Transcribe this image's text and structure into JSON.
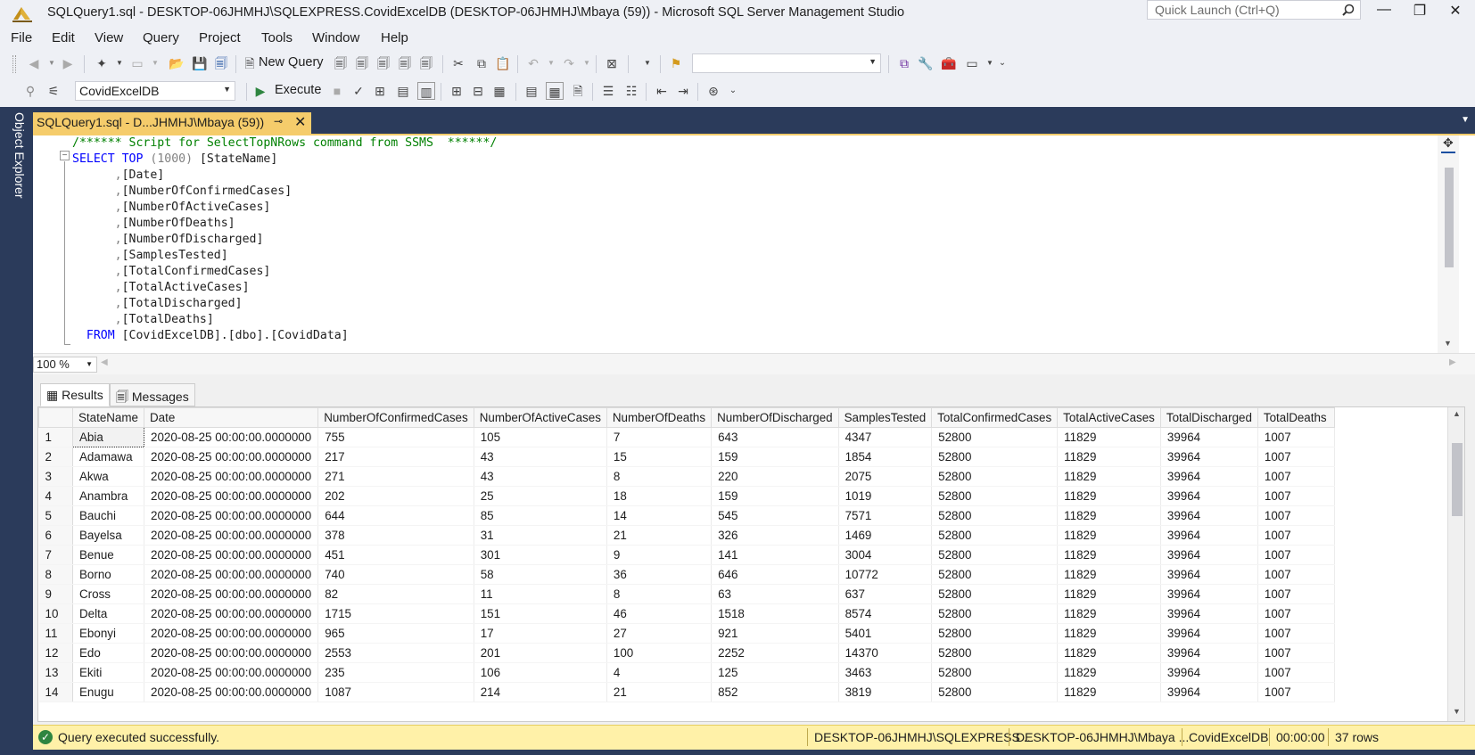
{
  "window": {
    "title": "SQLQuery1.sql - DESKTOP-06JHMHJ\\SQLEXPRESS.CovidExcelDB (DESKTOP-06JHMHJ\\Mbaya (59)) - Microsoft SQL Server Management Studio",
    "quick_launch_placeholder": "Quick Launch (Ctrl+Q)"
  },
  "menu": [
    "File",
    "Edit",
    "View",
    "Query",
    "Project",
    "Tools",
    "Window",
    "Help"
  ],
  "toolbar": {
    "new_query_label": "New Query",
    "database_selected": "CovidExcelDB",
    "execute_label": "Execute"
  },
  "side": {
    "object_explorer_label": "Object Explorer"
  },
  "doc_tab": {
    "label": "SQLQuery1.sql - D...JHMHJ\\Mbaya (59))"
  },
  "editor": {
    "comment": "/****** Script for SelectTopNRows command from SSMS  ******/",
    "select_kw": "SELECT",
    "top_kw": "TOP",
    "top_val": "(1000)",
    "first_col": "[StateName]",
    "columns": [
      "[Date]",
      "[NumberOfConfirmedCases]",
      "[NumberOfActiveCases]",
      "[NumberOfDeaths]",
      "[NumberOfDischarged]",
      "[SamplesTested]",
      "[TotalConfirmedCases]",
      "[TotalActiveCases]",
      "[TotalDischarged]",
      "[TotalDeaths]"
    ],
    "from_kw": "FROM",
    "from_table": "[CovidExcelDB].[dbo].[CovidData]",
    "zoom": "100 %"
  },
  "results": {
    "tab_results": "Results",
    "tab_messages": "Messages",
    "headers": [
      "StateName",
      "Date",
      "NumberOfConfirmedCases",
      "NumberOfActiveCases",
      "NumberOfDeaths",
      "NumberOfDischarged",
      "SamplesTested",
      "TotalConfirmedCases",
      "TotalActiveCases",
      "TotalDischarged",
      "TotalDeaths"
    ],
    "rows": [
      [
        "1",
        "Abia",
        "2020-08-25 00:00:00.0000000",
        "755",
        "105",
        "7",
        "643",
        "4347",
        "52800",
        "11829",
        "39964",
        "1007"
      ],
      [
        "2",
        "Adamawa",
        "2020-08-25 00:00:00.0000000",
        "217",
        "43",
        "15",
        "159",
        "1854",
        "52800",
        "11829",
        "39964",
        "1007"
      ],
      [
        "3",
        "Akwa",
        "2020-08-25 00:00:00.0000000",
        "271",
        "43",
        "8",
        "220",
        "2075",
        "52800",
        "11829",
        "39964",
        "1007"
      ],
      [
        "4",
        "Anambra",
        "2020-08-25 00:00:00.0000000",
        "202",
        "25",
        "18",
        "159",
        "1019",
        "52800",
        "11829",
        "39964",
        "1007"
      ],
      [
        "5",
        "Bauchi",
        "2020-08-25 00:00:00.0000000",
        "644",
        "85",
        "14",
        "545",
        "7571",
        "52800",
        "11829",
        "39964",
        "1007"
      ],
      [
        "6",
        "Bayelsa",
        "2020-08-25 00:00:00.0000000",
        "378",
        "31",
        "21",
        "326",
        "1469",
        "52800",
        "11829",
        "39964",
        "1007"
      ],
      [
        "7",
        "Benue",
        "2020-08-25 00:00:00.0000000",
        "451",
        "301",
        "9",
        "141",
        "3004",
        "52800",
        "11829",
        "39964",
        "1007"
      ],
      [
        "8",
        "Borno",
        "2020-08-25 00:00:00.0000000",
        "740",
        "58",
        "36",
        "646",
        "10772",
        "52800",
        "11829",
        "39964",
        "1007"
      ],
      [
        "9",
        "Cross",
        "2020-08-25 00:00:00.0000000",
        "82",
        "11",
        "8",
        "63",
        "637",
        "52800",
        "11829",
        "39964",
        "1007"
      ],
      [
        "10",
        "Delta",
        "2020-08-25 00:00:00.0000000",
        "1715",
        "151",
        "46",
        "1518",
        "8574",
        "52800",
        "11829",
        "39964",
        "1007"
      ],
      [
        "11",
        "Ebonyi",
        "2020-08-25 00:00:00.0000000",
        "965",
        "17",
        "27",
        "921",
        "5401",
        "52800",
        "11829",
        "39964",
        "1007"
      ],
      [
        "12",
        "Edo",
        "2020-08-25 00:00:00.0000000",
        "2553",
        "201",
        "100",
        "2252",
        "14370",
        "52800",
        "11829",
        "39964",
        "1007"
      ],
      [
        "13",
        "Ekiti",
        "2020-08-25 00:00:00.0000000",
        "235",
        "106",
        "4",
        "125",
        "3463",
        "52800",
        "11829",
        "39964",
        "1007"
      ],
      [
        "14",
        "Enugu",
        "2020-08-25 00:00:00.0000000",
        "1087",
        "214",
        "21",
        "852",
        "3819",
        "52800",
        "11829",
        "39964",
        "1007"
      ]
    ]
  },
  "status": {
    "message": "Query executed successfully.",
    "server": "DESKTOP-06JHMHJ\\SQLEXPRESS ...",
    "user": "DESKTOP-06JHMHJ\\Mbaya ...",
    "database": "CovidExcelDB",
    "elapsed": "00:00:00",
    "rows": "37 rows"
  }
}
